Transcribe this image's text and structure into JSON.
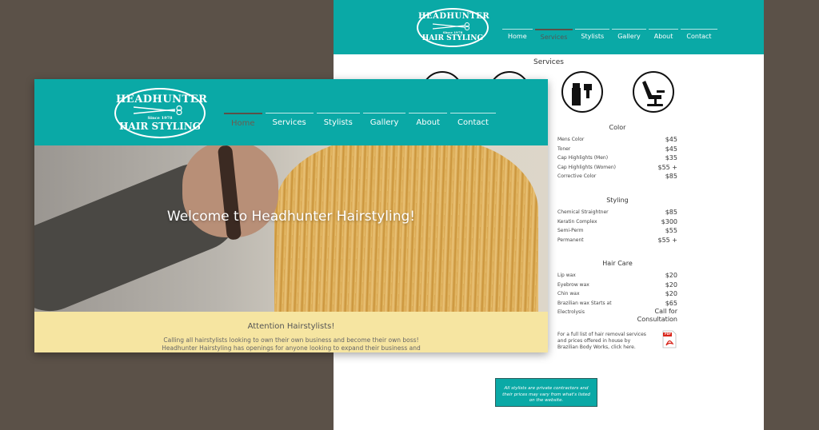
{
  "logo": {
    "line1": "HEADHUNTER",
    "line2": "Since 1978",
    "line3": "HAIR STYLING"
  },
  "nav": [
    "Home",
    "Services",
    "Stylists",
    "Gallery",
    "About",
    "Contact"
  ],
  "back": {
    "active_nav": "Services",
    "services_title": "Services",
    "icons": [
      "razor-icon",
      "clippers-icon",
      "hair-dye-icon",
      "salon-chair-icon"
    ],
    "color": {
      "title": "Color",
      "items": [
        {
          "name": "Mens Color",
          "price": "$45"
        },
        {
          "name": "Toner",
          "price": "$45"
        },
        {
          "name": "Cap Highlights (Men)",
          "price": "$35"
        },
        {
          "name": "Cap Highlights (Women)",
          "price": "$55 +"
        },
        {
          "name": "Corrective Color",
          "price": "$85"
        }
      ]
    },
    "styling": {
      "title": "Styling",
      "items": [
        {
          "name": "Chemical Straightner",
          "price": "$85"
        },
        {
          "name": "Keratin Complex",
          "price": "$300"
        },
        {
          "name": "Semi-Perm",
          "price": "$55"
        },
        {
          "name": "Permanent",
          "price": "$55 +"
        }
      ]
    },
    "haircare": {
      "title": "Hair Care",
      "items": [
        {
          "name": "Lip wax",
          "price": "$20"
        },
        {
          "name": "Eyebrow wax",
          "price": "$20"
        },
        {
          "name": "Chin wax",
          "price": "$20"
        },
        {
          "name": "Brazilian wax Starts at",
          "price": "$65"
        },
        {
          "name": "Electrolysis",
          "price": "Call for Consultation"
        }
      ]
    },
    "note": "For a full list of hair removal services and prices offered in house by Brazilian Body Works, click here.",
    "pdf_label": "PDF",
    "footnote": "All stylists are private contractors and their prices may vary from what's listed on the website."
  },
  "front": {
    "active_nav": "Home",
    "hero_title": "Welcome to Headhunter Hairstyling!",
    "attention_title": "Attention Hairstylists!",
    "attention_body": "Calling all hairstylists looking to own their own business and become their own boss! Headhunter Hairstyling has openings for anyone looking to expand their business and"
  },
  "colors": {
    "teal": "#0aa9a6",
    "backdrop": "#5b5148",
    "banner": "#f6e5a1",
    "pdf_red": "#d9261c"
  }
}
